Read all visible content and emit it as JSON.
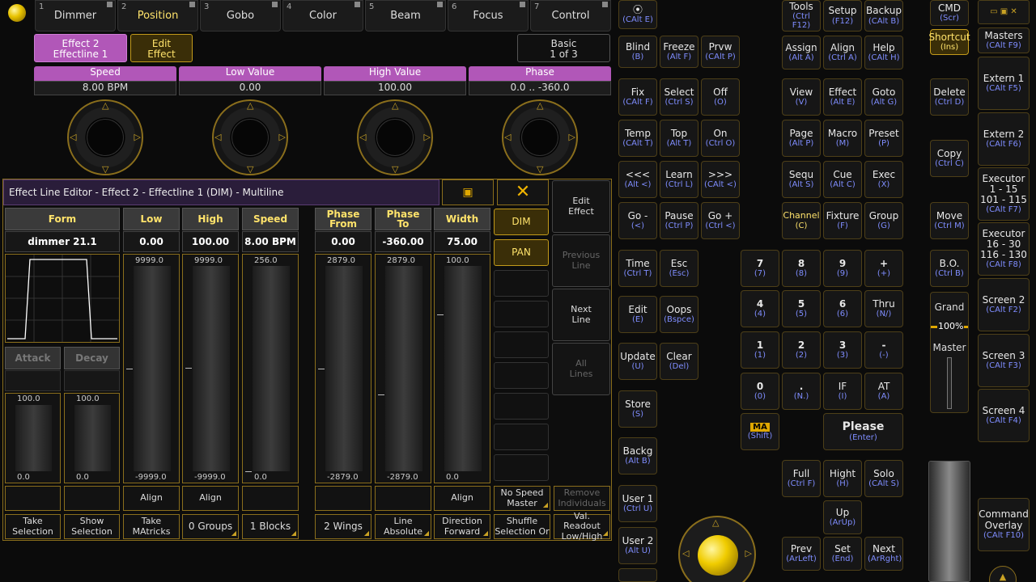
{
  "presetTabs": [
    {
      "num": "1",
      "label": "Dimmer"
    },
    {
      "num": "2",
      "label": "Position"
    },
    {
      "num": "3",
      "label": "Gobo"
    },
    {
      "num": "4",
      "label": "Color"
    },
    {
      "num": "5",
      "label": "Beam"
    },
    {
      "num": "6",
      "label": "Focus"
    },
    {
      "num": "7",
      "label": "Control"
    }
  ],
  "effect": {
    "line1": "Effect 2",
    "line2": "Effectline 1",
    "edit1": "Edit",
    "edit2": "Effect",
    "basic1": "Basic",
    "basic2": "1 of 3"
  },
  "encoders": [
    {
      "label": "Speed",
      "value": "8.00 BPM"
    },
    {
      "label": "Low Value",
      "value": "0.00"
    },
    {
      "label": "High Value",
      "value": "100.00"
    },
    {
      "label": "Phase",
      "value": "0.0 .. -360.0"
    }
  ],
  "editor": {
    "title": "Effect Line Editor - Effect 2 - Effectline 1 (DIM) - Multiline",
    "form_label": "Form",
    "form_value": "dimmer 21.1",
    "attack": "Attack",
    "decay": "Decay",
    "columns": [
      {
        "h1": "Low",
        "h2": "",
        "value": "0.00",
        "top": "9999.0",
        "bottom": "-9999.0"
      },
      {
        "h1": "High",
        "h2": "",
        "value": "100.00",
        "top": "9999.0",
        "bottom": "-9999.0"
      },
      {
        "h1": "Speed",
        "h2": "",
        "value": "8.00 BPM",
        "top": "256.0",
        "bottom": "0.0"
      },
      {
        "h1": "Phase",
        "h2": "From",
        "value": "0.00",
        "top": "2879.0",
        "bottom": "-2879.0"
      },
      {
        "h1": "Phase",
        "h2": "To",
        "value": "-360.00",
        "top": "2879.0",
        "bottom": "-2879.0"
      },
      {
        "h1": "Width",
        "h2": "",
        "value": "75.00",
        "top": "100.0",
        "bottom": "0.0"
      }
    ],
    "attack_top": "100.0",
    "attack_bot": "0.0",
    "decay_top": "100.0",
    "decay_bot": "0.0",
    "attrs": [
      "DIM",
      "PAN"
    ],
    "side": [
      {
        "a": "Edit",
        "b": "Effect"
      },
      {
        "a": "Previous",
        "b": "Line"
      },
      {
        "a": "Next",
        "b": "Line"
      },
      {
        "a": "All",
        "b": "Lines"
      }
    ],
    "align": "Align",
    "noSpeed1": "No Speed",
    "noSpeed2": "Master",
    "remove1": "Remove",
    "remove2": "Individuals",
    "bottom": [
      {
        "a": "Take",
        "b": "Selection"
      },
      {
        "a": "Show",
        "b": "Selection"
      },
      {
        "a": "Take",
        "b": "MAtricks"
      },
      {
        "a": "0 Groups",
        "b": ""
      },
      {
        "a": "1 Blocks",
        "b": ""
      },
      {
        "a": "2 Wings",
        "b": ""
      },
      {
        "a": "Line",
        "b": "Absolute"
      },
      {
        "a": "Direction",
        "b": "Forward"
      },
      {
        "a": "Shuffle",
        "b": "Selection Or"
      },
      {
        "a": "Val. Readout",
        "b": "Low/High"
      }
    ]
  },
  "keys": {
    "calte": [
      "",
      "(CAlt E)"
    ],
    "blind": [
      "Blind",
      "(B)"
    ],
    "freeze": [
      "Freeze",
      "(Alt F)"
    ],
    "prvw": [
      "Prvw",
      "(CAlt P)"
    ],
    "fix": [
      "Fix",
      "(CAlt F)"
    ],
    "select": [
      "Select",
      "(Ctrl S)"
    ],
    "off": [
      "Off",
      "(O)"
    ],
    "temp": [
      "Temp",
      "(CAlt T)"
    ],
    "top": [
      "Top",
      "(Alt T)"
    ],
    "on": [
      "On",
      "(Ctrl O)"
    ],
    "prev3": [
      "<<<",
      "(Alt <)"
    ],
    "learn": [
      "Learn",
      "(Ctrl L)"
    ],
    "next3": [
      ">>>",
      "(CAlt <)"
    ],
    "gominus": [
      "Go -",
      "(<)"
    ],
    "pause": [
      "Pause",
      "(Ctrl P)"
    ],
    "goplus": [
      "Go +",
      "(Ctrl <)"
    ],
    "time": [
      "Time",
      "(Ctrl T)"
    ],
    "esc": [
      "Esc",
      "(Esc)"
    ],
    "edit": [
      "Edit",
      "(E)"
    ],
    "oops": [
      "Oops",
      "(Bspce)"
    ],
    "update": [
      "Update",
      "(U)"
    ],
    "clear": [
      "Clear",
      "(Del)"
    ],
    "store": [
      "Store",
      "(S)"
    ],
    "backg": [
      "Backg",
      "(Alt B)"
    ],
    "user1": [
      "User 1",
      "(Ctrl U)"
    ],
    "user2": [
      "User 2",
      "(Alt U)"
    ],
    "tools": [
      "Tools",
      "(Ctrl F12)"
    ],
    "setup": [
      "Setup",
      "(F12)"
    ],
    "backup": [
      "Backup",
      "(CAlt B)"
    ],
    "assign": [
      "Assign",
      "(Alt A)"
    ],
    "align": [
      "Align",
      "(Ctrl A)"
    ],
    "help": [
      "Help",
      "(CAlt H)"
    ],
    "view": [
      "View",
      "(V)"
    ],
    "effect": [
      "Effect",
      "(Alt E)"
    ],
    "goto": [
      "Goto",
      "(Alt G)"
    ],
    "page": [
      "Page",
      "(Alt P)"
    ],
    "macro": [
      "Macro",
      "(M)"
    ],
    "preset": [
      "Preset",
      "(P)"
    ],
    "sequ": [
      "Sequ",
      "(Alt S)"
    ],
    "cue": [
      "Cue",
      "(Alt C)"
    ],
    "exec": [
      "Exec",
      "(X)"
    ],
    "channel": [
      "Channel",
      "(C)"
    ],
    "fixture": [
      "Fixture",
      "(F)"
    ],
    "group": [
      "Group",
      "(G)"
    ],
    "k7": [
      "7",
      "(7)"
    ],
    "k8": [
      "8",
      "(8)"
    ],
    "k9": [
      "9",
      "(9)"
    ],
    "kplus": [
      "+",
      "(+)"
    ],
    "k4": [
      "4",
      "(4)"
    ],
    "k5": [
      "5",
      "(5)"
    ],
    "k6": [
      "6",
      "(6)"
    ],
    "thru": [
      "Thru",
      "(N/)"
    ],
    "k1": [
      "1",
      "(1)"
    ],
    "k2": [
      "2",
      "(2)"
    ],
    "k3": [
      "3",
      "(3)"
    ],
    "kminus": [
      "-",
      "(-)"
    ],
    "k0": [
      "0",
      "(0)"
    ],
    "kdot": [
      ".",
      "(N.)"
    ],
    "kif": [
      "IF",
      "(I)"
    ],
    "kat": [
      "AT",
      "(A)"
    ],
    "shift": [
      "MA",
      "(Shift)"
    ],
    "please": [
      "Please",
      "(Enter)"
    ],
    "full": [
      "Full",
      "(Ctrl F)"
    ],
    "hight": [
      "Hight",
      "(H)"
    ],
    "solo": [
      "Solo",
      "(CAlt S)"
    ],
    "up": [
      "Up",
      "(ArUp)"
    ],
    "prev": [
      "Prev",
      "(ArLeft)"
    ],
    "set": [
      "Set",
      "(End)"
    ],
    "next": [
      "Next",
      "(ArRght)"
    ],
    "cmd": [
      "CMD",
      "(Scr)"
    ],
    "shortcut": [
      "Shortcut",
      "(Ins)"
    ],
    "delete": [
      "Delete",
      "(Ctrl D)"
    ],
    "copy": [
      "Copy",
      "(Ctrl C)"
    ],
    "move": [
      "Move",
      "(Ctrl M)"
    ],
    "bo": [
      "B.O.",
      "(Ctrl B)"
    ],
    "grand": "Grand",
    "grandpct": "100%",
    "master": "Master",
    "masters": [
      "Masters",
      "(CAlt F9)"
    ],
    "extern1": [
      "Extern 1",
      "(CAlt F5)"
    ],
    "extern2": [
      "Extern 2",
      "(CAlt F6)"
    ],
    "exec1a": "Executor",
    "exec1b": "1 - 15",
    "exec1c": "101 - 115",
    "exec1d": "(CAlt F7)",
    "exec2a": "Executor",
    "exec2b": "16 - 30",
    "exec2c": "116 - 130",
    "exec2d": "(CAlt F8)",
    "screen2": [
      "Screen 2",
      "(CAlt F2)"
    ],
    "screen3": [
      "Screen 3",
      "(CAlt F3)"
    ],
    "screen4": [
      "Screen 4",
      "(CAlt F4)"
    ],
    "cmdoverlay1": "Command",
    "cmdoverlay2": "Overlay",
    "cmdoverlay3": "(CAlt F10)"
  }
}
